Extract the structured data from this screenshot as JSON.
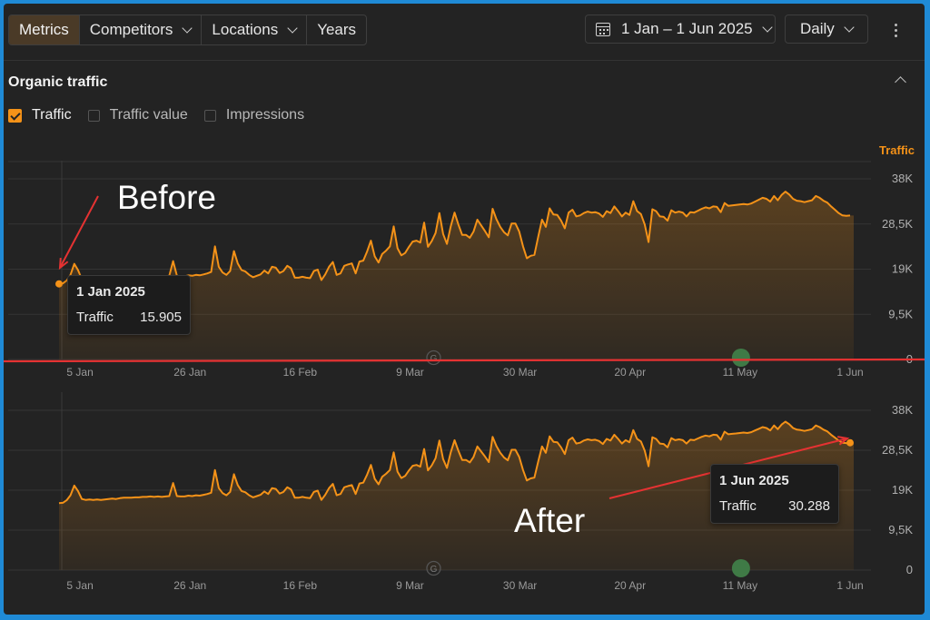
{
  "toolbar": {
    "tabs": [
      {
        "label": "Metrics",
        "active": true,
        "dropdown": false
      },
      {
        "label": "Competitors",
        "dropdown": true
      },
      {
        "label": "Locations",
        "dropdown": true
      },
      {
        "label": "Years",
        "dropdown": false
      }
    ],
    "date_range": "1 Jan – 1 Jun 2025",
    "granularity": "Daily",
    "icons": [
      "calendar-icon",
      "chevron-down-icon",
      "more-vertical-icon"
    ]
  },
  "section": {
    "title": "Organic traffic",
    "collapse_icon": "chevron-up-icon",
    "checkboxes": [
      {
        "label": "Traffic",
        "checked": true
      },
      {
        "label": "Traffic value",
        "checked": false
      },
      {
        "label": "Impressions",
        "checked": false
      }
    ]
  },
  "colors": {
    "line": "#f49218",
    "annotation_arrow": "#e53232",
    "event_marker": "#3f7a46"
  },
  "chart_data": [
    {
      "type": "area",
      "panel": "Before",
      "ylabel": "Traffic",
      "ylim": [
        0,
        38000
      ],
      "y_ticks": [
        "38K",
        "28,5K",
        "19K",
        "9,5K",
        "0"
      ],
      "x_ticks": [
        "5 Jan",
        "26 Jan",
        "16 Feb",
        "9 Mar",
        "30 Mar",
        "20 Apr",
        "11 May",
        "1 Jun"
      ],
      "x_start": "1 Jan 2025",
      "x_end": "1 Jun 2025",
      "values": [
        15905,
        16000,
        16600,
        17800,
        20100,
        18800,
        16900,
        16700,
        16800,
        16700,
        16800,
        16700,
        16800,
        16900,
        17000,
        16900,
        17100,
        17200,
        17200,
        17200,
        17300,
        17300,
        17400,
        17400,
        17500,
        17400,
        17500,
        17400,
        17500,
        17600,
        20700,
        17600,
        17500,
        17500,
        17700,
        17600,
        17800,
        17700,
        17900,
        18100,
        18400,
        23800,
        19500,
        18300,
        17800,
        18600,
        22800,
        20200,
        18800,
        18500,
        17800,
        17300,
        17600,
        17900,
        18700,
        18100,
        19500,
        19300,
        18200,
        18600,
        19700,
        19200,
        17200,
        17200,
        17400,
        17200,
        17100,
        18600,
        18900,
        16700,
        17900,
        19500,
        20500,
        17800,
        18100,
        19700,
        20000,
        20200,
        18100,
        20600,
        20800,
        22700,
        25000,
        21700,
        20400,
        22200,
        22900,
        23800,
        28000,
        23400,
        21900,
        22400,
        23700,
        24800,
        25000,
        24600,
        28800,
        23700,
        24900,
        26600,
        30800,
        26400,
        24300,
        28000,
        30900,
        28400,
        26200,
        26200,
        25600,
        26900,
        29400,
        28200,
        27000,
        25700,
        31700,
        29500,
        27900,
        26800,
        26100,
        28600,
        28600,
        26900,
        23800,
        21300,
        21800,
        22000,
        25800,
        29400,
        27900,
        31800,
        30500,
        30400,
        29200,
        27600,
        30900,
        31500,
        30100,
        30300,
        30800,
        31100,
        30900,
        31000,
        30700,
        30000,
        31200,
        30800,
        32200,
        31200,
        30100,
        30900,
        30400,
        33300,
        31200,
        30600,
        28400,
        24700,
        31600,
        31200,
        30100,
        30000,
        29200,
        31400,
        30900,
        31100,
        30900,
        30100,
        31000,
        30900,
        31300,
        31700,
        32000,
        31800,
        32200,
        32100,
        31000,
        32900,
        32300,
        32400,
        32500,
        32600,
        32700,
        32600,
        32800,
        33200,
        33600,
        34000,
        33800,
        33200,
        34400,
        33500,
        34600,
        35300,
        34700,
        33800,
        33400,
        33300,
        33100,
        33300,
        33500,
        34400,
        34000,
        33400,
        33000,
        32200,
        31500,
        30800,
        30300,
        30200,
        30288
      ]
    },
    {
      "type": "area",
      "panel": "After",
      "ylim": [
        0,
        38000
      ],
      "y_ticks": [
        "38K",
        "28,5K",
        "19K",
        "9,5K",
        "0"
      ],
      "x_ticks": [
        "5 Jan",
        "26 Jan",
        "16 Feb",
        "9 Mar",
        "30 Mar",
        "20 Apr",
        "11 May",
        "1 Jun"
      ],
      "x_start": "1 Jan 2025",
      "x_end": "1 Jun 2025",
      "same_series_as": "Before"
    }
  ],
  "annotations": {
    "before_label": "Before",
    "after_label": "After",
    "tooltip_start": {
      "date": "1 Jan 2025",
      "series": "Traffic",
      "value": "15.905"
    },
    "tooltip_end": {
      "date": "1 Jun 2025",
      "series": "Traffic",
      "value": "30.288"
    },
    "event_marker_date": "11 May",
    "google_marker_date": "9 Mar",
    "google_marker_icon": "google-update-icon"
  }
}
